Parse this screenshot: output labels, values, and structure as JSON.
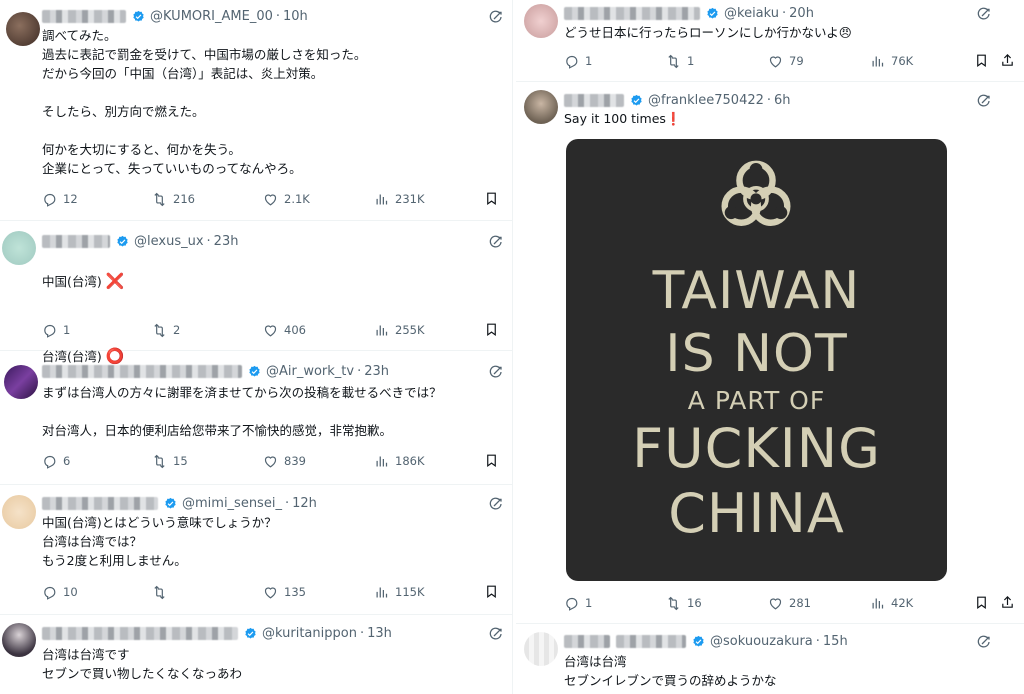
{
  "left": {
    "tweets": [
      {
        "handle": "@KUMORI_AME_00",
        "time": "10h",
        "body": "調べてみた。\n過去に表記で罰金を受けて、中国市場の厳しさを知った。\nだから今回の「中国（台湾）」表記は、炎上対策。\n\nそしたら、別方向で燃えた。\n\n何かを大切にすると、何かを失う。\n企業にとって、失っていいものってなんやろ。",
        "replies": "12",
        "reposts": "216",
        "likes": "2.1K",
        "views": "231K"
      },
      {
        "handle": "@lexus_ux",
        "time": "23h",
        "line1": "中国(台湾)",
        "line2": "台湾(台湾)",
        "mark1": "❌",
        "mark2": "⭕",
        "replies": "1",
        "reposts": "2",
        "likes": "406",
        "views": "255K"
      },
      {
        "handle": "@Air_work_tv",
        "time": "23h",
        "body": "まずは台湾人の方々に謝罪を済ませてから次の投稿を載せるべきでは？\n\n对台湾人，日本的便利店给您带来了不愉快的感觉，非常抱歉。",
        "replies": "6",
        "reposts": "15",
        "likes": "839",
        "views": "186K"
      },
      {
        "handle": "@mimi_sensei_",
        "time": "12h",
        "body": "中国(台湾)とはどういう意味でしょうか？\n台湾は台湾では？\nもう2度と利用しません。",
        "replies": "10",
        "reposts": "",
        "likes": "135",
        "views": "115K"
      },
      {
        "handle": "@kuritanippon",
        "time": "13h",
        "body": "台湾は台湾です\nセブンで買い物したくなくなっあわ"
      }
    ]
  },
  "right": {
    "tweets": [
      {
        "handle": "@keiaku",
        "time": "20h",
        "body": "どうせ日本に行ったらローソンにしか行かないよ😠",
        "replies": "1",
        "reposts": "1",
        "likes": "79",
        "views": "76K"
      },
      {
        "handle": "@franklee750422",
        "time": "6h",
        "body": "Say it 100 times❗",
        "poster": {
          "line1": "TAIWAN",
          "line2": "IS NOT",
          "line3": "A PART OF",
          "line4": "FUCKING",
          "line5": "CHINA"
        },
        "replies": "1",
        "reposts": "16",
        "likes": "281",
        "views": "42K"
      },
      {
        "handle": "@sokuouzakura",
        "time": "15h",
        "body": "台湾は台湾\nセブンイレブンで買うの辞めようかな"
      }
    ]
  },
  "icons": {
    "reply": "reply-icon",
    "repost": "repost-icon",
    "like": "heart-icon",
    "views": "views-icon",
    "bookmark": "bookmark-icon",
    "share": "share-icon",
    "grok": "grok-icon",
    "verified": "verified-badge-icon"
  },
  "colors": {
    "verified": "#1d9bf0",
    "meta": "#536471",
    "poster_bg": "#2a2a2a",
    "poster_text": "#d4cfb5"
  }
}
